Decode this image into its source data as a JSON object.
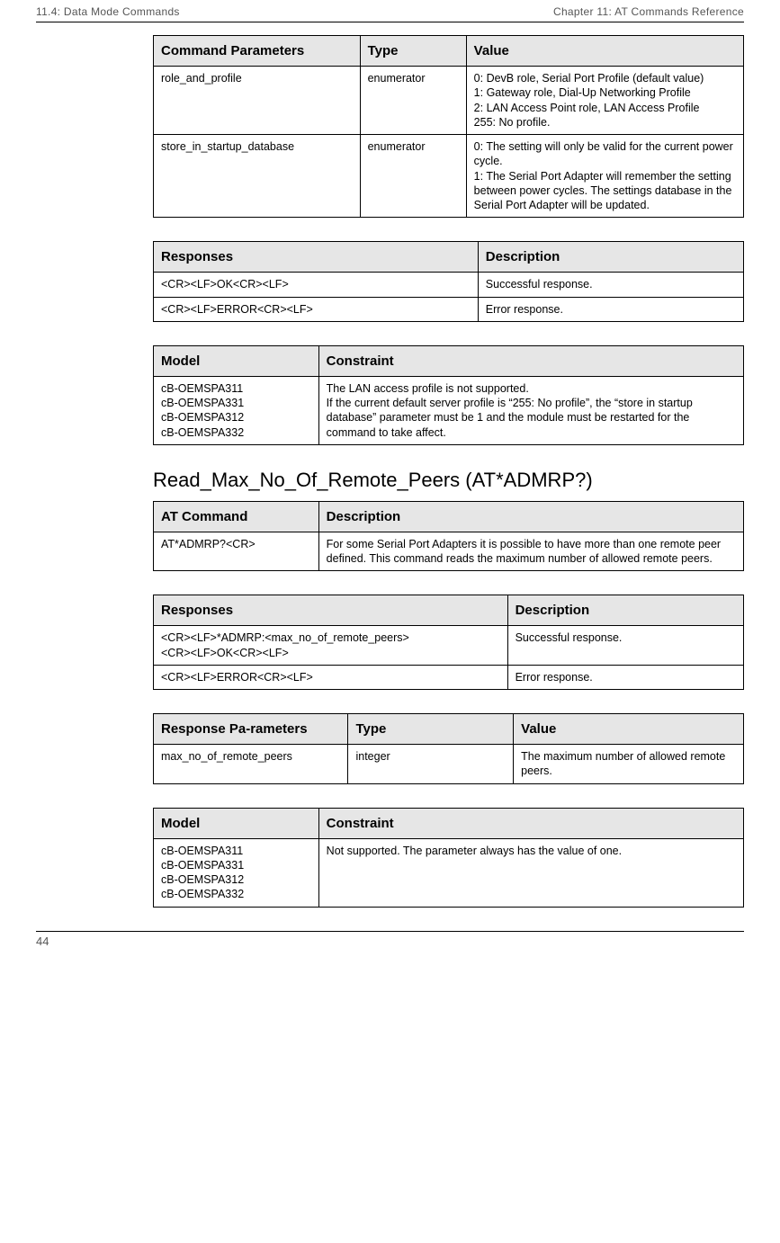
{
  "header": {
    "left": "11.4: Data Mode Commands",
    "right": "Chapter 11: AT Commands Reference"
  },
  "table1": {
    "headers": [
      "Command Parameters",
      "Type",
      "Value"
    ],
    "rows": [
      {
        "param": "role_and_profile",
        "type": "enumerator",
        "value": "0: DevB role, Serial Port Profile (default value)\n1: Gateway role, Dial-Up Networking Profile\n2: LAN Access Point role, LAN Access Profile\n255: No profile."
      },
      {
        "param": "store_in_startup_database",
        "type": "enumerator",
        "value": "0: The setting will only be valid for the current power cycle.\n1: The Serial Port Adapter will remember the setting between power cycles. The settings database in the Serial Port Adapter will be updated."
      }
    ]
  },
  "table2": {
    "headers": [
      "Responses",
      "Description"
    ],
    "rows": [
      {
        "resp": "<CR><LF>OK<CR><LF>",
        "desc": "Successful response."
      },
      {
        "resp": "<CR><LF>ERROR<CR><LF>",
        "desc": "Error response."
      }
    ]
  },
  "table3": {
    "headers": [
      "Model",
      "Constraint"
    ],
    "rows": [
      {
        "model": "cB-OEMSPA311\ncB-OEMSPA331\ncB-OEMSPA312\ncB-OEMSPA332",
        "constraint": "The LAN access profile is not supported.\nIf the current default server profile is “255: No profile”, the “store in startup database” parameter must be 1 and the module must be restarted for the command to take affect."
      }
    ]
  },
  "section_title": "Read_Max_No_Of_Remote_Peers (AT*ADMRP?)",
  "table4": {
    "headers": [
      "AT Command",
      "Description"
    ],
    "rows": [
      {
        "cmd": "AT*ADMRP?<CR>",
        "desc": "For some Serial Port Adapters it is possible to have more than one remote peer defined. This command reads the maximum number of allowed remote peers."
      }
    ]
  },
  "table5": {
    "headers": [
      "Responses",
      "Description"
    ],
    "rows": [
      {
        "resp": "<CR><LF>*ADMRP:<max_no_of_remote_peers>\n<CR><LF>OK<CR><LF>",
        "desc": "Successful response."
      },
      {
        "resp": "<CR><LF>ERROR<CR><LF>",
        "desc": "Error response."
      }
    ]
  },
  "table6": {
    "headers": [
      "Response Pa-rameters",
      "Type",
      "Value"
    ],
    "rows": [
      {
        "param": "max_no_of_remote_peers",
        "type": "integer",
        "value": "The maximum number of allowed remote peers."
      }
    ]
  },
  "table7": {
    "headers": [
      "Model",
      "Constraint"
    ],
    "rows": [
      {
        "model": "cB-OEMSPA311\ncB-OEMSPA331\ncB-OEMSPA312\ncB-OEMSPA332",
        "constraint": "Not supported. The parameter always has the value of one."
      }
    ]
  },
  "footer": {
    "page_number": "44"
  }
}
